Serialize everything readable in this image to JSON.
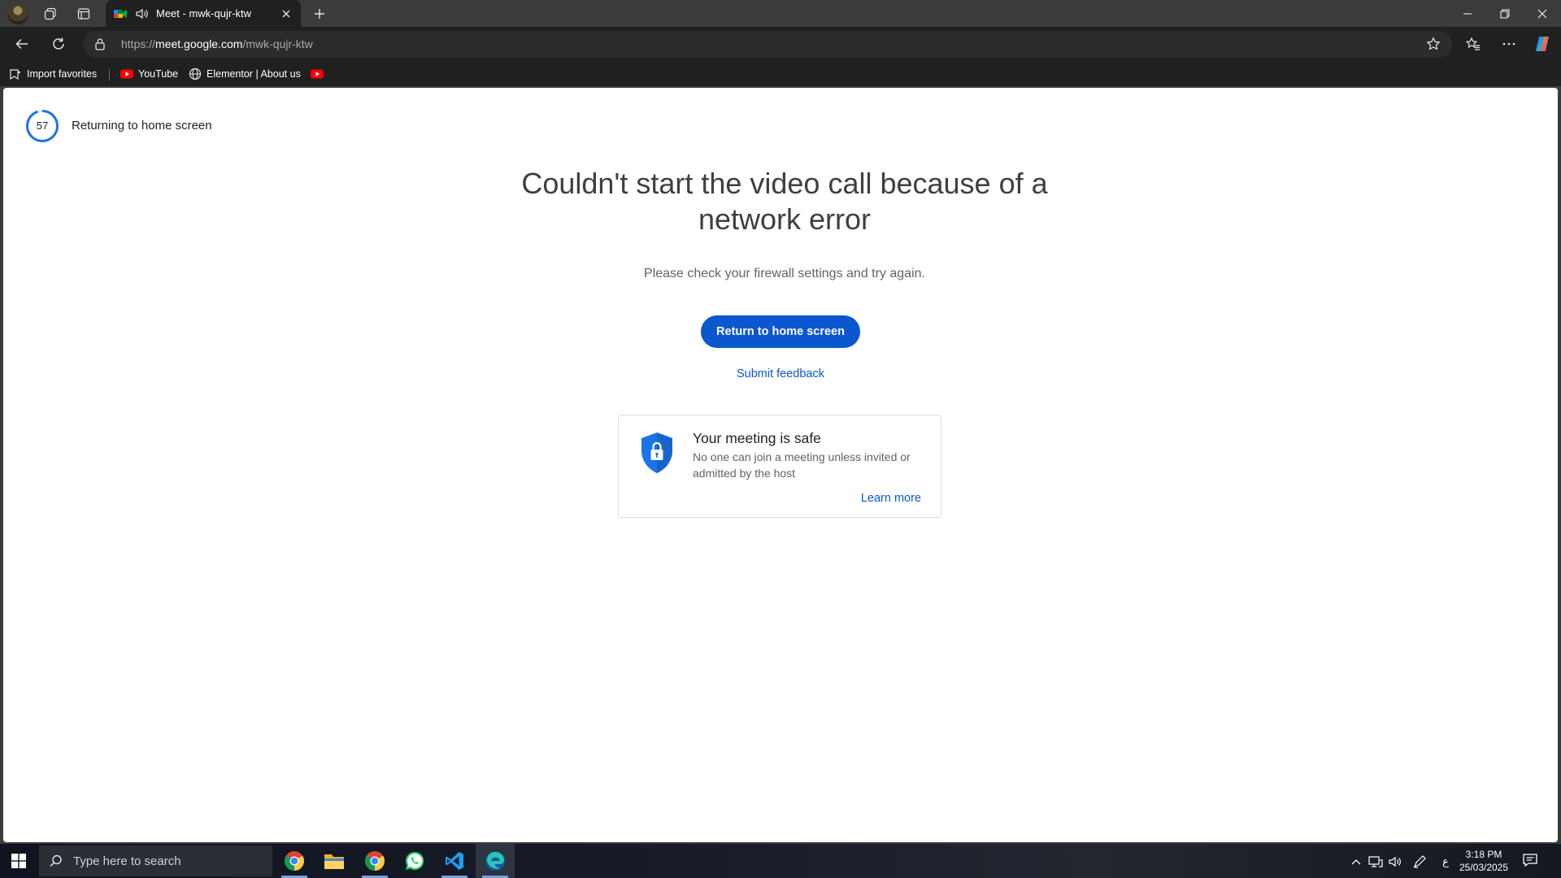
{
  "browser": {
    "tab": {
      "title": "Meet - mwk-qujr-ktw"
    },
    "url": {
      "scheme": "https://",
      "host": "meet.google.com",
      "path": "/mwk-qujr-ktw"
    },
    "bookmarks": [
      {
        "label": "Import favorites"
      },
      {
        "label": "YouTube"
      },
      {
        "label": "Elementor | About us"
      }
    ]
  },
  "page": {
    "countdown": {
      "value": "57",
      "status_text": "Returning to home screen",
      "progress": 0.95
    },
    "headline": "Couldn't start the video call because of a network error",
    "subtext": "Please check your firewall settings and try again.",
    "primary_button": "Return to home screen",
    "feedback_link": "Submit feedback",
    "safety_card": {
      "title": "Your meeting is safe",
      "body": "No one can join a meeting unless invited or admitted by the host",
      "link": "Learn more"
    }
  },
  "taskbar": {
    "search_placeholder": "Type here to search",
    "apps": [
      "chrome-icon",
      "file-explorer-icon",
      "chrome-icon",
      "whatsapp-icon",
      "vscode-icon",
      "edge-icon"
    ],
    "tray_lang": "ع",
    "time": "3:18 PM",
    "date": "25/03/2025"
  },
  "colors": {
    "accent_blue": "#0b57d0",
    "countdown_ring": "#1a73e8",
    "browser_chrome": "#202020",
    "title_bar": "#3b3b3b"
  }
}
